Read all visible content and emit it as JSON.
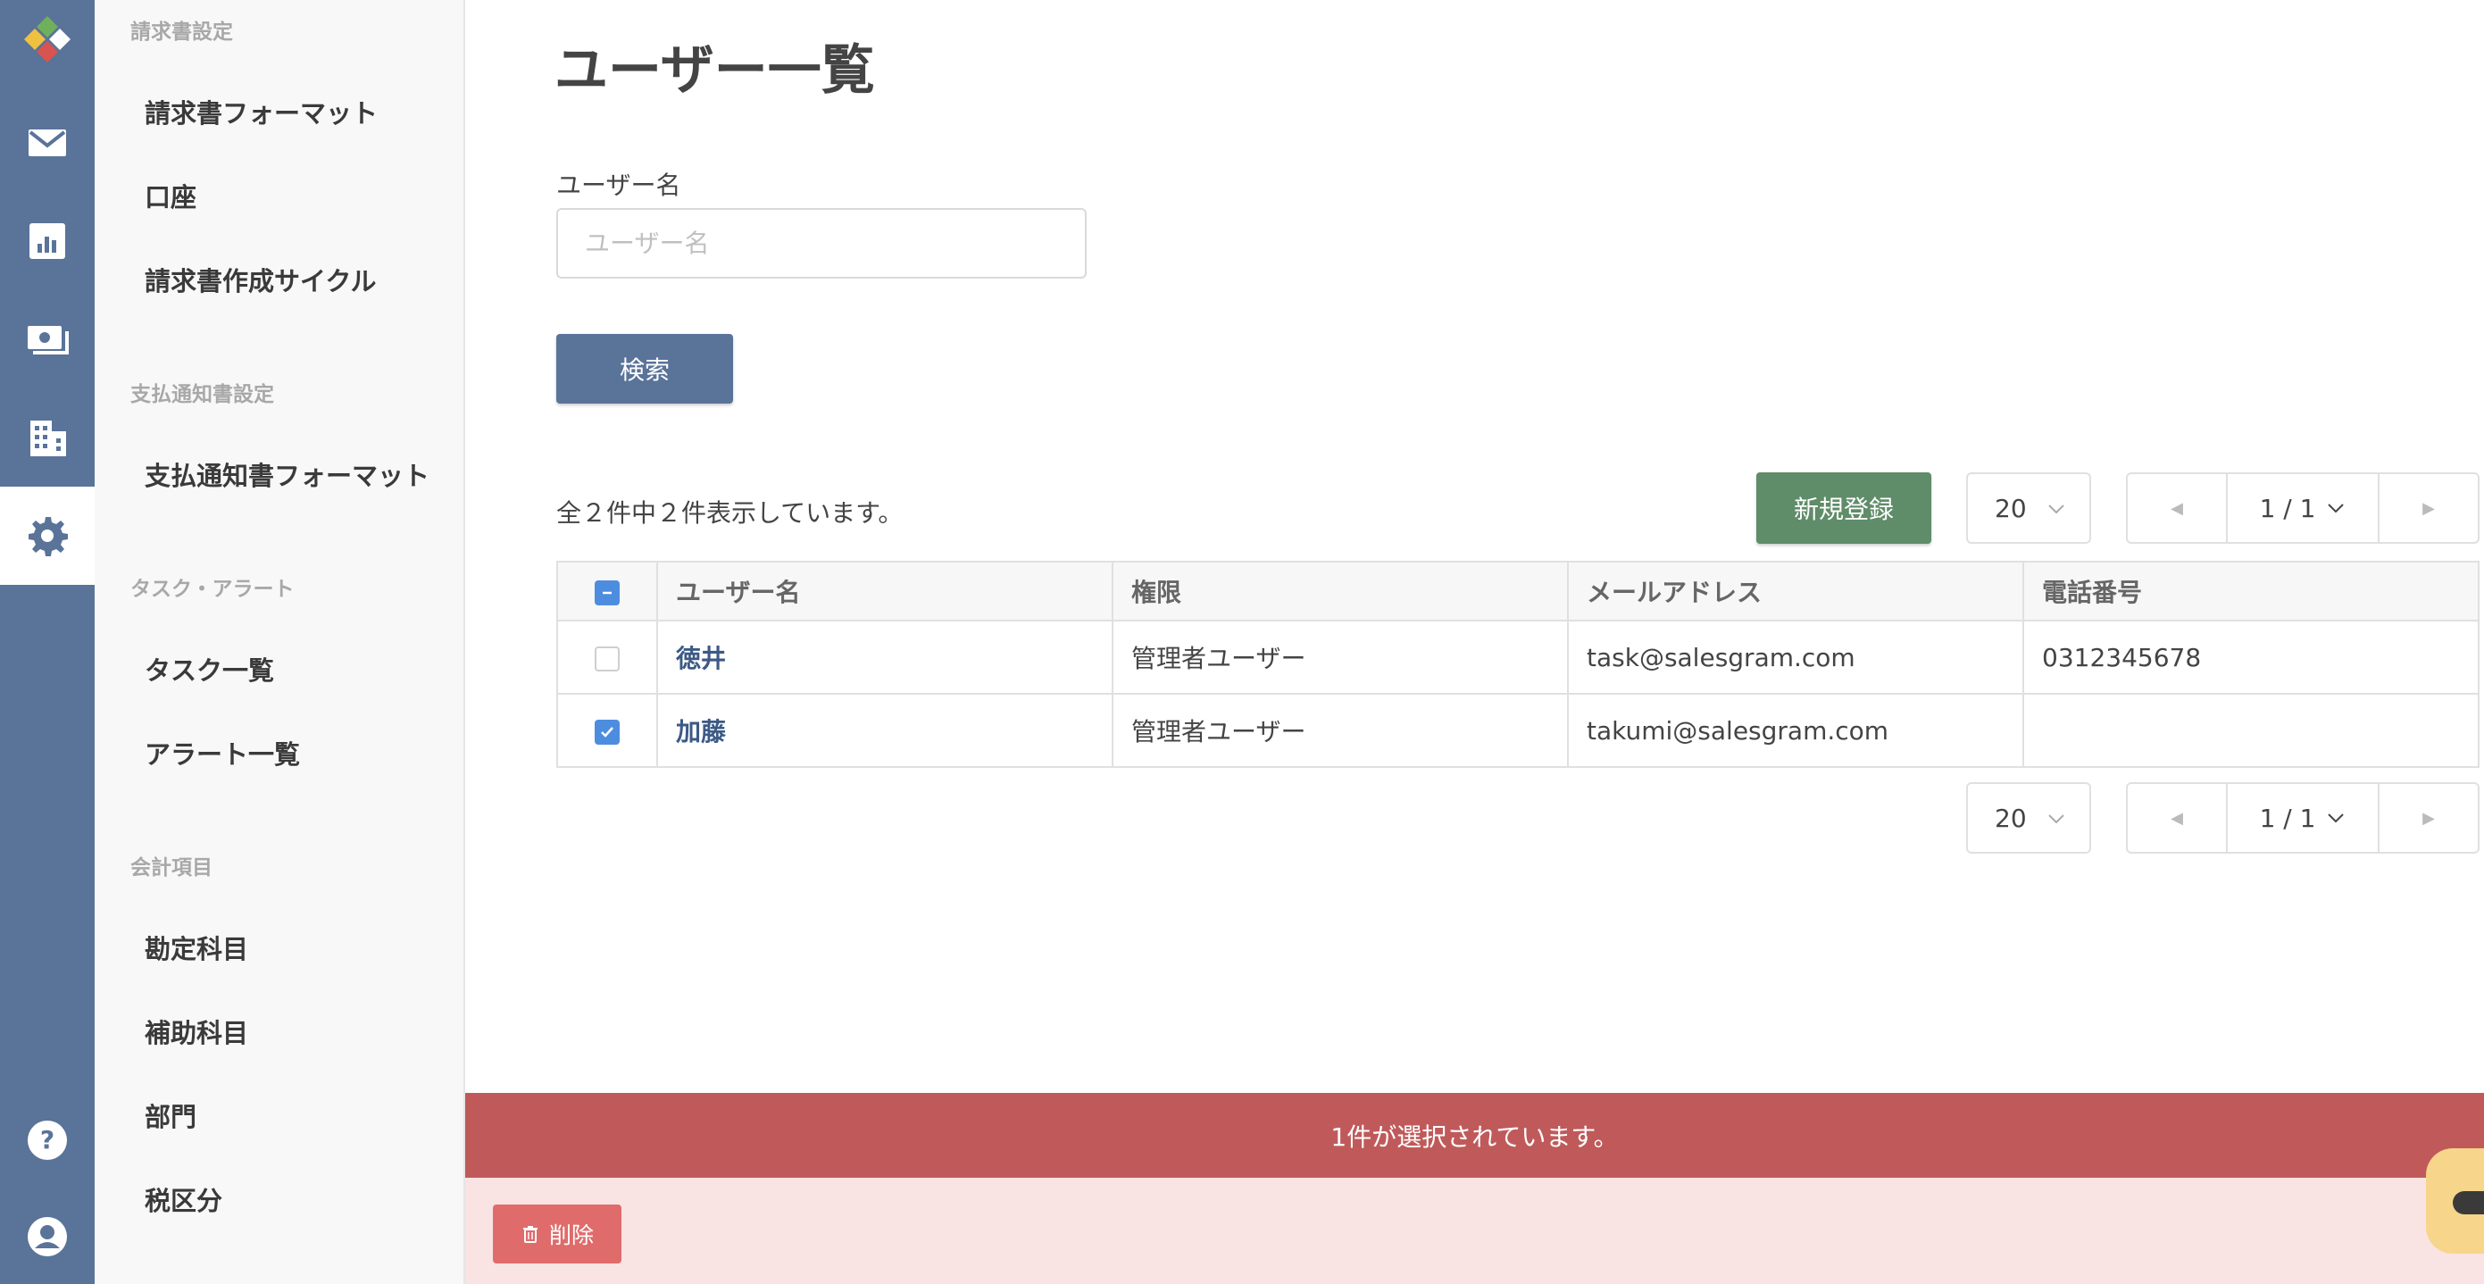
{
  "sidebar": {
    "sections": [
      {
        "title": "請求書設定",
        "items": [
          "請求書フォーマット",
          "口座",
          "請求書作成サイクル"
        ]
      },
      {
        "title": "支払通知書設定",
        "items": [
          "支払通知書フォーマット"
        ]
      },
      {
        "title": "タスク・アラート",
        "items": [
          "タスク一覧",
          "アラート一覧"
        ]
      },
      {
        "title": "会計項目",
        "items": [
          "勘定科目",
          "補助科目",
          "部門",
          "税区分"
        ]
      }
    ]
  },
  "page": {
    "title": "ユーザー一覧",
    "username_label": "ユーザー名",
    "username_placeholder": "ユーザー名",
    "search_button": "検索",
    "summary": "全２件中２件表示しています。",
    "new_button": "新規登録",
    "page_size": "20",
    "page_indicator": "1 / 1"
  },
  "table": {
    "headers": [
      "ユーザー名",
      "権限",
      "メールアドレス",
      "電話番号"
    ],
    "rows": [
      {
        "name": "徳井",
        "role": "管理者ユーザー",
        "email": "task@salesgram.com",
        "phone": "0312345678",
        "checked": false
      },
      {
        "name": "加藤",
        "role": "管理者ユーザー",
        "email": "takumi@salesgram.com",
        "phone": "",
        "checked": true
      }
    ]
  },
  "selection": {
    "message": "1件が選択されています。",
    "delete_button": "削除"
  },
  "colors": {
    "rail": "#5a7399",
    "primary": "#5a7399",
    "success": "#5f8c69",
    "danger_bar": "#c05a5a",
    "danger_button": "#e06b6b",
    "checkbox": "#4d8de0"
  }
}
